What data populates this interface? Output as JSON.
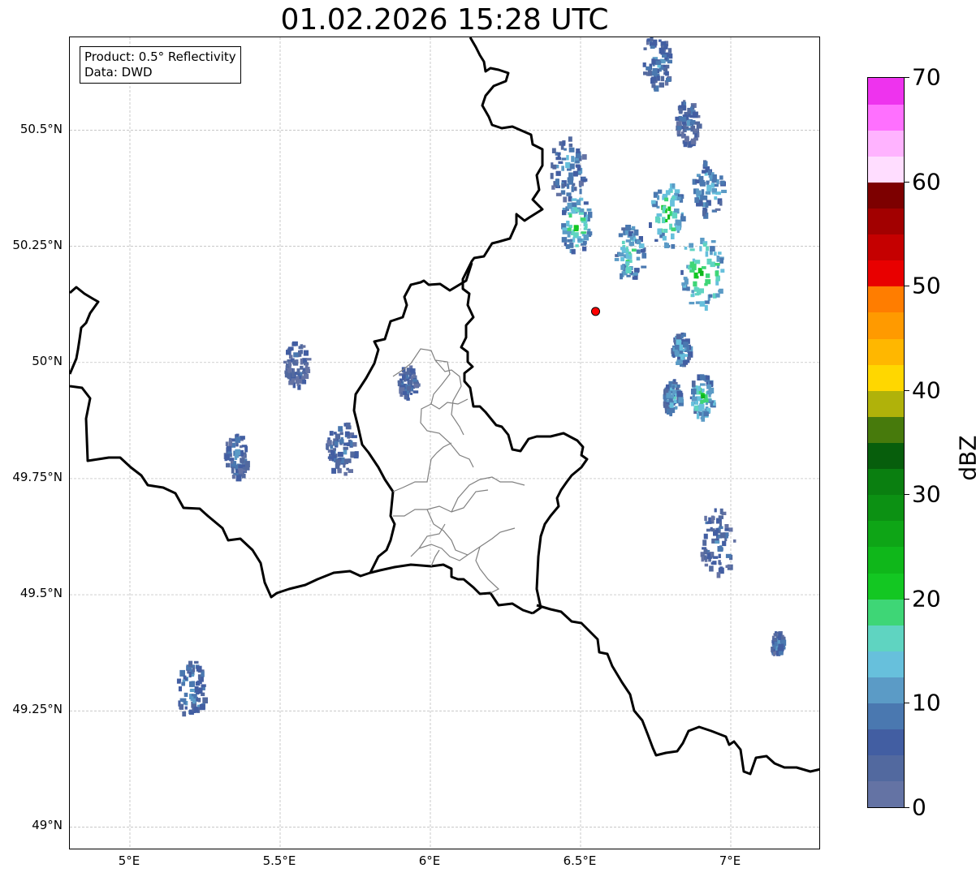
{
  "title": "01.02.2026 15:28 UTC",
  "info": {
    "product": "Product: 0.5° Reflectivity",
    "data": "Data: DWD"
  },
  "axes": {
    "lat_ticks": [
      "50.5°N",
      "50.25°N",
      "50°N",
      "49.75°N",
      "49.5°N",
      "49.25°N",
      "49°N"
    ],
    "lon_ticks": [
      "5°E",
      "5.5°E",
      "6°E",
      "6.5°E",
      "7°E"
    ]
  },
  "colorbar": {
    "label": "dBZ",
    "tick_labels": [
      "0",
      "10",
      "20",
      "30",
      "40",
      "50",
      "60",
      "70"
    ],
    "colors": [
      "#6473a4",
      "#52699f",
      "#425ea2",
      "#4a78b0",
      "#5b9bc6",
      "#67c0dc",
      "#5fd4c1",
      "#3ed676",
      "#13c722",
      "#0fb71a",
      "#0ea516",
      "#0c9113",
      "#0a7f10",
      "#075e0c",
      "#477a0c",
      "#b0b20a",
      "#ffd700",
      "#ffb700",
      "#ff9a00",
      "#ff7d00",
      "#e80000",
      "#c50000",
      "#a20000",
      "#7d0000",
      "#ffddff",
      "#ffb3ff",
      "#ff70ff",
      "#ee33ee"
    ]
  },
  "radar_site": {
    "name": "radar-site",
    "lon": 6.55,
    "lat": 50.11,
    "color": "#ff0000"
  },
  "map": {
    "lon_range": [
      4.8,
      7.3
    ],
    "lat_range": [
      48.95,
      50.7
    ],
    "border_color": "#000000",
    "region_border_color": "#808080",
    "precip_cells": [
      {
        "lon": 6.45,
        "lat": 50.42,
        "dbz": 12,
        "spread": 0.06
      },
      {
        "lon": 6.48,
        "lat": 50.3,
        "dbz": 22,
        "spread": 0.05
      },
      {
        "lon": 6.66,
        "lat": 50.24,
        "dbz": 18,
        "spread": 0.05
      },
      {
        "lon": 6.78,
        "lat": 50.32,
        "dbz": 22,
        "spread": 0.06
      },
      {
        "lon": 6.9,
        "lat": 50.2,
        "dbz": 24,
        "spread": 0.07
      },
      {
        "lon": 6.92,
        "lat": 50.38,
        "dbz": 15,
        "spread": 0.05
      },
      {
        "lon": 6.75,
        "lat": 50.65,
        "dbz": 10,
        "spread": 0.05
      },
      {
        "lon": 6.85,
        "lat": 50.52,
        "dbz": 8,
        "spread": 0.04
      },
      {
        "lon": 6.83,
        "lat": 50.03,
        "dbz": 15,
        "spread": 0.03
      },
      {
        "lon": 6.9,
        "lat": 49.93,
        "dbz": 20,
        "spread": 0.04
      },
      {
        "lon": 6.8,
        "lat": 49.93,
        "dbz": 14,
        "spread": 0.03
      },
      {
        "lon": 6.95,
        "lat": 49.62,
        "dbz": 8,
        "spread": 0.06
      },
      {
        "lon": 7.15,
        "lat": 49.4,
        "dbz": 10,
        "spread": 0.02
      },
      {
        "lon": 5.55,
        "lat": 50.0,
        "dbz": 6,
        "spread": 0.04
      },
      {
        "lon": 5.7,
        "lat": 49.82,
        "dbz": 8,
        "spread": 0.05
      },
      {
        "lon": 5.35,
        "lat": 49.8,
        "dbz": 8,
        "spread": 0.04
      },
      {
        "lon": 5.92,
        "lat": 49.96,
        "dbz": 8,
        "spread": 0.03
      },
      {
        "lon": 5.2,
        "lat": 49.3,
        "dbz": 12,
        "spread": 0.05
      }
    ]
  }
}
